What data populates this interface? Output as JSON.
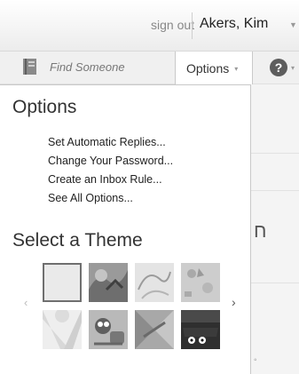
{
  "header": {
    "sign_out_label": "sign out",
    "user_name": "Akers, Kim",
    "user_menu_icon": "chevron-down-icon"
  },
  "toolbar": {
    "address_book_icon": "address-book-icon",
    "find_placeholder": "Find Someone",
    "options_label": "Options",
    "options_chevron": "▾",
    "help_label": "?",
    "help_chevron": "▾"
  },
  "options_menu": {
    "title": "Options",
    "links": [
      "Set Automatic Replies...",
      "Change Your Password...",
      "Create an Inbox Rule...",
      "See All Options..."
    ],
    "theme_title": "Select a Theme",
    "prev_arrow": "‹",
    "next_arrow": "›",
    "themes": [
      {
        "name": "default",
        "selected": true
      },
      {
        "name": "pattern-gray"
      },
      {
        "name": "sketch"
      },
      {
        "name": "leaves"
      },
      {
        "name": "rays"
      },
      {
        "name": "robot"
      },
      {
        "name": "geometric"
      },
      {
        "name": "dark-cat"
      }
    ]
  },
  "background": {
    "partial_glyph": "ח",
    "bottom_glyph": "◦"
  },
  "colors": {
    "menu_border": "#c9c9c9",
    "selected_theme_border": "#6f6f6f",
    "help_button": "#5d5d5d"
  }
}
